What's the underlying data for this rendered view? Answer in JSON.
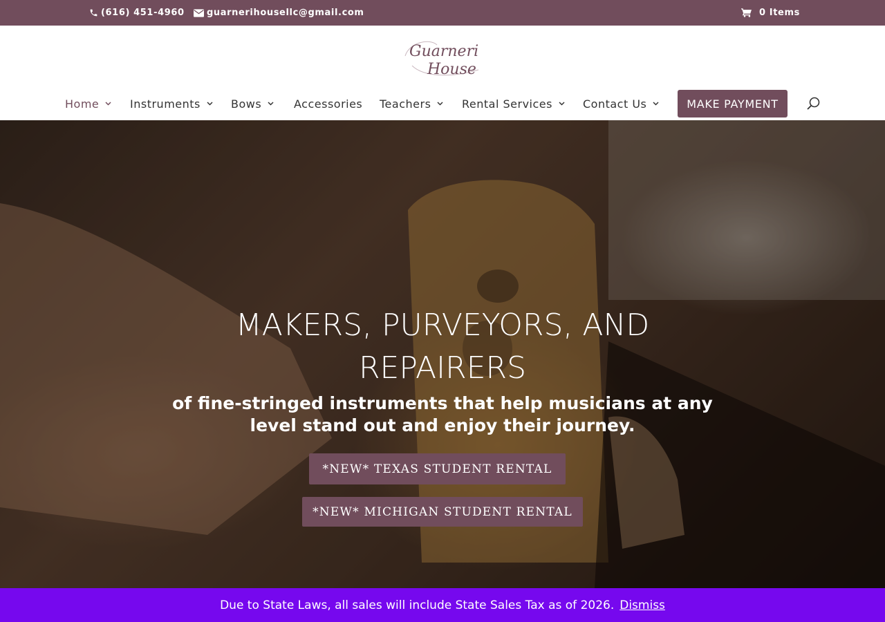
{
  "topbar": {
    "phone": "(616) 451-4960",
    "email": "guarnerihousellc@gmail.com",
    "cart": "0 Items",
    "icons": [
      "phone-icon",
      "envelope-icon",
      "cart-icon"
    ]
  },
  "logo": {
    "line1": "Guarneri",
    "line2": "House"
  },
  "nav": {
    "items": [
      {
        "label": "Home",
        "dropdown": true,
        "active": true
      },
      {
        "label": "Instruments",
        "dropdown": true
      },
      {
        "label": "Bows",
        "dropdown": true
      },
      {
        "label": "Accessories",
        "dropdown": false
      },
      {
        "label": "Teachers",
        "dropdown": true
      },
      {
        "label": "Rental Services",
        "dropdown": true
      },
      {
        "label": "Contact Us",
        "dropdown": true
      }
    ],
    "cta": "MAKE PAYMENT",
    "search_icon": "search-icon"
  },
  "hero": {
    "title_line1": "MAKERS, PURVEYORS, AND",
    "title_line2": "REPAIRERS",
    "subtitle_line1": "of fine-stringed instruments that help musicians at any",
    "subtitle_line2": "level stand out and enjoy their journey.",
    "button1": "*NEW* TEXAS STUDENT RENTAL",
    "button2": "*NEW* MICHIGAN STUDENT RENTAL"
  },
  "notice": {
    "text": "Due to State  Laws, all sales will include State Sales Tax as of 2026.",
    "dismiss": "Dismiss"
  },
  "colors": {
    "brand": "#714d5c",
    "notice": "#7608ee"
  }
}
